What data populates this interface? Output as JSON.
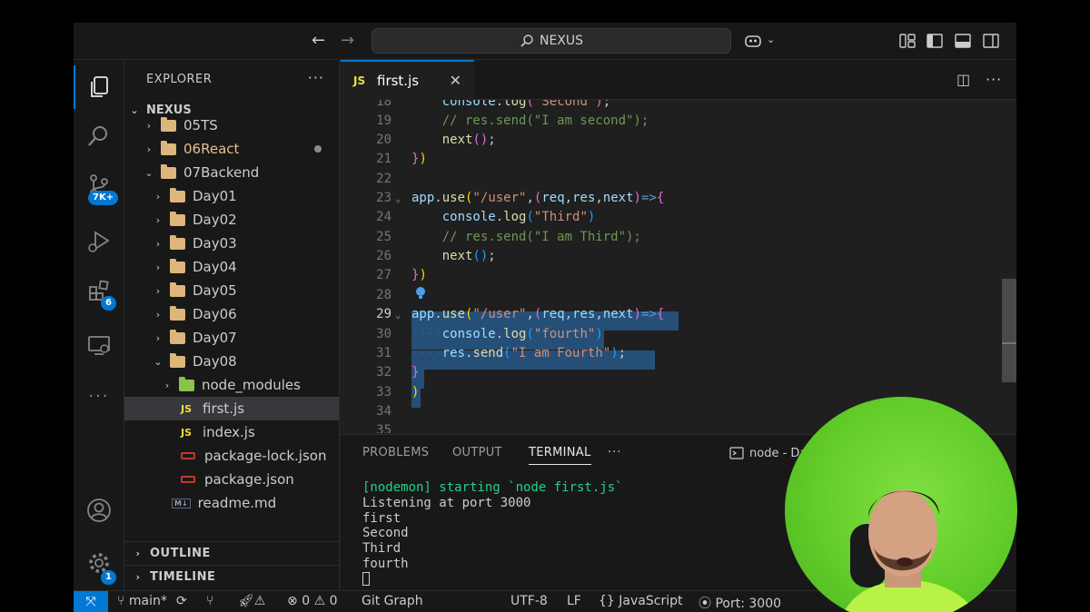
{
  "titlebar": {
    "search_text": "NEXUS"
  },
  "activity": {
    "source_control_badge": "7K+",
    "extensions_badge": "6",
    "settings_badge": "1"
  },
  "sidebar": {
    "title": "EXPLORER",
    "more": "···",
    "root": "NEXUS",
    "items": [
      {
        "label": "05TS"
      },
      {
        "label": "06React"
      },
      {
        "label": "07Backend"
      },
      {
        "label": "Day01"
      },
      {
        "label": "Day02"
      },
      {
        "label": "Day03"
      },
      {
        "label": "Day04"
      },
      {
        "label": "Day05"
      },
      {
        "label": "Day06"
      },
      {
        "label": "Day07"
      },
      {
        "label": "Day08"
      },
      {
        "label": "node_modules"
      },
      {
        "label": "first.js",
        "icon": "JS"
      },
      {
        "label": "index.js",
        "icon": "JS"
      },
      {
        "label": "package-lock.json"
      },
      {
        "label": "package.json"
      },
      {
        "label": "readme.md",
        "icon": "M↓"
      }
    ],
    "outline": "OUTLINE",
    "timeline": "TIMELINE"
  },
  "editor": {
    "tab_icon": "JS",
    "tab_label": "first.js",
    "line_numbers": [
      "18",
      "19",
      "20",
      "21",
      "22",
      "23",
      "24",
      "25",
      "26",
      "27",
      "28",
      "29",
      "30",
      "31",
      "32",
      "33",
      "34",
      "35"
    ]
  },
  "panel": {
    "tabs": [
      "PROBLEMS",
      "OUTPUT",
      "TERMINAL"
    ],
    "more": "···",
    "terminal_name": "node - Da",
    "terminal_lines": [
      "[nodemon] starting `node first.js`",
      "Listening at port 3000",
      "first",
      "Second",
      "Third",
      "fourth"
    ]
  },
  "status": {
    "branch": "main*",
    "errors": "0",
    "warnings": "0",
    "git_graph": "Git Graph",
    "encoding": "UTF-8",
    "eol": "LF",
    "language": "JavaScript",
    "port": "Port: 3000"
  }
}
